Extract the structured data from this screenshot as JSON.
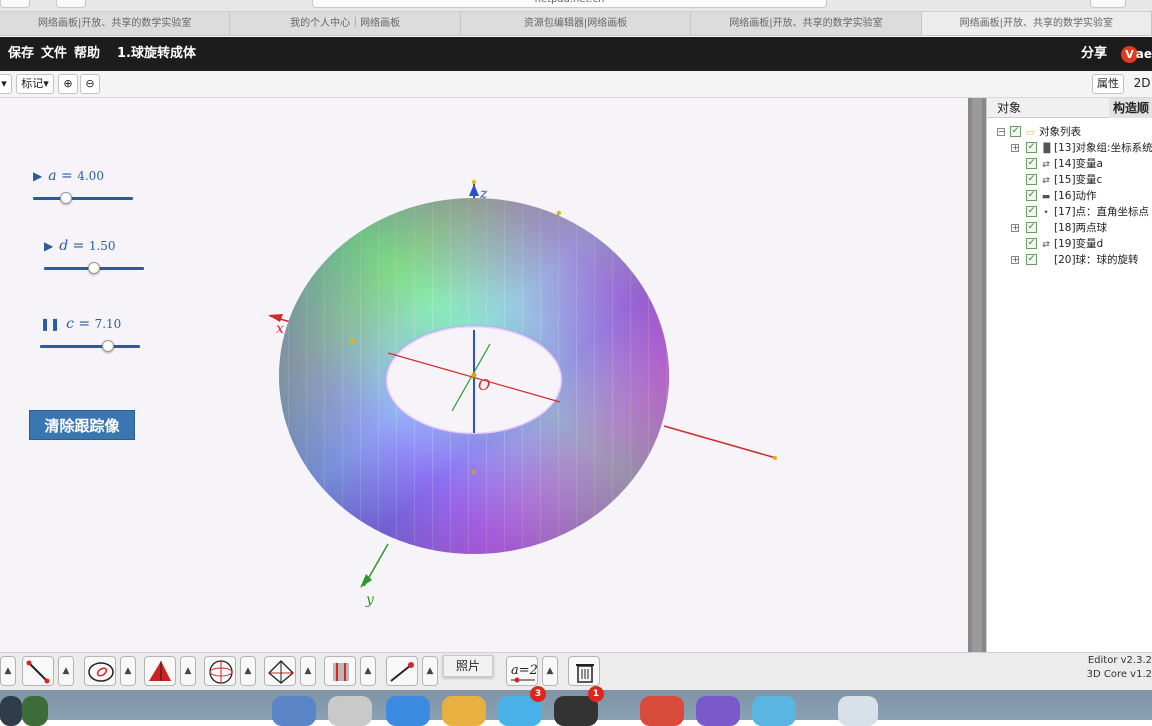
{
  "browser": {
    "url": "netpad.net.cn",
    "tabs": [
      "网络画板|开放、共享的数学实验室",
      "我的个人中心｜网络画板",
      "资源包编辑器|网络画板",
      "网络画板|开放、共享的数学实验室",
      "网络画板|开放、共享的数学实验室"
    ]
  },
  "appbar": {
    "menu": [
      "保存",
      "文件",
      "帮助"
    ],
    "title": "1.球旋转成体",
    "share": "分享",
    "logo_letter": "V",
    "logo_tail": "ae"
  },
  "toolbar": {
    "dropdown_partial": "",
    "mark_label": "标记",
    "zoom_in_icon": "zoom-in-icon",
    "zoom_out_icon": "zoom-out-icon",
    "properties": "属性",
    "mode": "2D"
  },
  "sliders": [
    {
      "name": "a",
      "value": "4.00",
      "state": "play",
      "fraction": 0.33
    },
    {
      "name": "d",
      "value": "1.50",
      "state": "play",
      "fraction": 0.5
    },
    {
      "name": "c",
      "value": "7.10",
      "state": "pause",
      "fraction": 0.68
    }
  ],
  "clear_trace": "清除跟踪像",
  "axes": {
    "x": "x",
    "y": "y",
    "z": "z",
    "origin": "O"
  },
  "panel": {
    "tab_objects": "对象",
    "tab_construct": "构造顺",
    "tree_root": "对象列表",
    "items": [
      {
        "label": "[13]对象组:坐标系统",
        "icon": "chart-icon",
        "expand": true
      },
      {
        "label": "[14]变量a",
        "icon": "variable-icon",
        "expand": false
      },
      {
        "label": "[15]变量c",
        "icon": "variable-icon",
        "expand": false
      },
      {
        "label": "[16]动作",
        "icon": "action-icon",
        "expand": false
      },
      {
        "label": "[17]点：直角坐标点",
        "icon": "point-icon",
        "expand": false
      },
      {
        "label": "[18]两点球",
        "icon": "",
        "expand": true
      },
      {
        "label": "[19]变量d",
        "icon": "variable-icon",
        "expand": false
      },
      {
        "label": "[20]球：球的旋转",
        "icon": "",
        "expand": true
      }
    ]
  },
  "tooltip": "照片",
  "version": {
    "editor": "Editor v2.3.2",
    "core": "3D Core v1.2"
  },
  "dock": {
    "badges": [
      "3",
      "1"
    ]
  },
  "colors": {
    "accent": "#3a76b0",
    "slider": "#2b5d9e",
    "x_axis": "#d22b2b",
    "y_axis": "#2a9a2a",
    "z_axis": "#2b50c8"
  }
}
